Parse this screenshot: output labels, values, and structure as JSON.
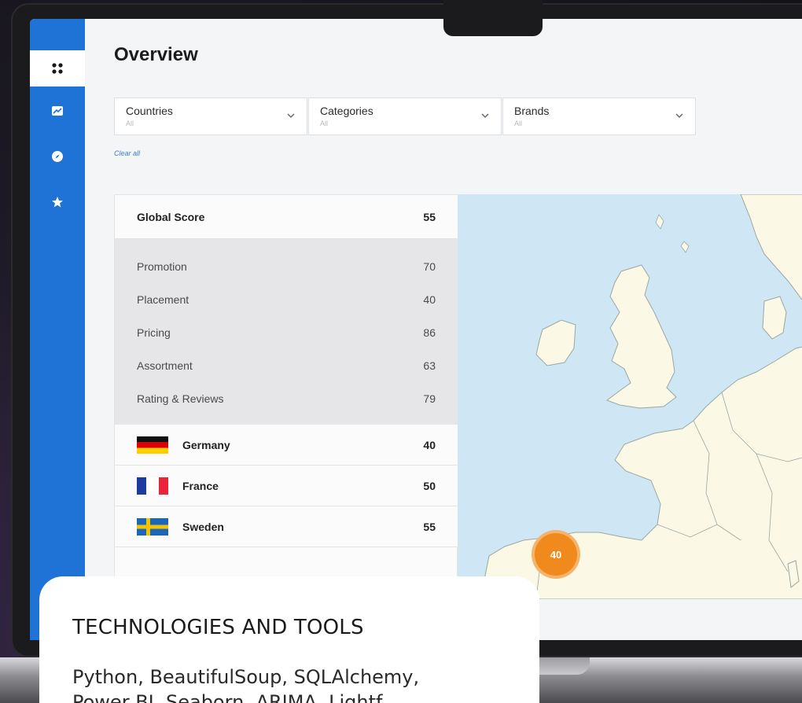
{
  "page": {
    "title": "Overview"
  },
  "sidebar": {
    "items": [
      {
        "icon": "dashboard-icon",
        "active": true
      },
      {
        "icon": "chart-icon",
        "active": false
      },
      {
        "icon": "compass-icon",
        "active": false
      },
      {
        "icon": "star-icon",
        "active": false
      }
    ]
  },
  "filters": [
    {
      "label": "Countries",
      "value": "All"
    },
    {
      "label": "Categories",
      "value": "All"
    },
    {
      "label": "Brands",
      "value": "All"
    }
  ],
  "clear_all": "Clear all",
  "scores": {
    "global": {
      "label": "Global Score",
      "value": "55"
    },
    "breakdown": [
      {
        "label": "Promotion",
        "value": "70"
      },
      {
        "label": "Placement",
        "value": "40"
      },
      {
        "label": "Pricing",
        "value": "86"
      },
      {
        "label": "Assortment",
        "value": "63"
      },
      {
        "label": "Rating & Reviews",
        "value": "79"
      }
    ],
    "countries": [
      {
        "name": "Germany",
        "value": "40",
        "flag": "germany-flag-icon"
      },
      {
        "name": "France",
        "value": "50",
        "flag": "france-flag-icon"
      },
      {
        "name": "Sweden",
        "value": "55",
        "flag": "sweden-flag-icon"
      }
    ]
  },
  "map": {
    "marker_value": "40",
    "marker_color": "#f08a1c"
  },
  "colors": {
    "sidebar": "#1f73d6",
    "map_water": "#cfe7f5",
    "map_land": "#fbf8e6"
  },
  "tech_card": {
    "title": "TECHNOLOGIES AND TOOLS",
    "line1": "Python, BeautifulSoup, SQLAlchemy,",
    "line2": "Power BI, Seaborn, ARIMA, Lightf"
  }
}
